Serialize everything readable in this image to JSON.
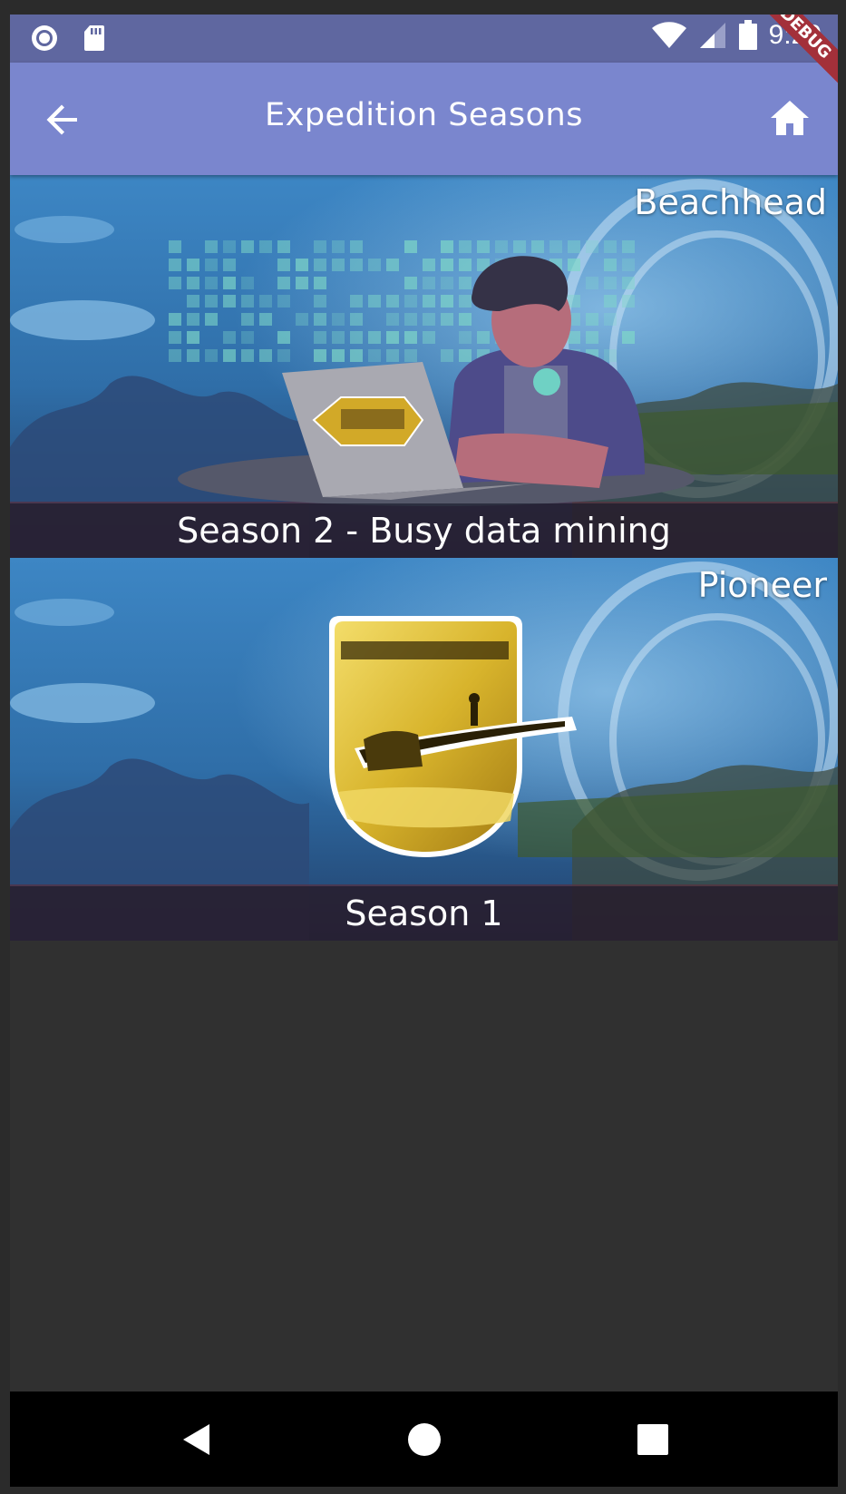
{
  "status_bar": {
    "time": "9:29",
    "icons": [
      "record-icon",
      "sd-card-icon",
      "wifi-icon",
      "signal-icon",
      "battery-icon"
    ]
  },
  "debug_banner": "DEBUG",
  "app_bar": {
    "title": "Expedition Seasons",
    "back_icon": "arrow-back-icon",
    "home_icon": "home-icon",
    "color": "#7a86ce"
  },
  "seasons": [
    {
      "tag": "Beachhead",
      "caption": "Season 2 - Busy data mining"
    },
    {
      "tag": "Pioneer",
      "caption": "Season 1"
    }
  ],
  "nav_bar": {
    "icons": [
      "nav-back-icon",
      "nav-home-icon",
      "nav-recents-icon"
    ]
  }
}
